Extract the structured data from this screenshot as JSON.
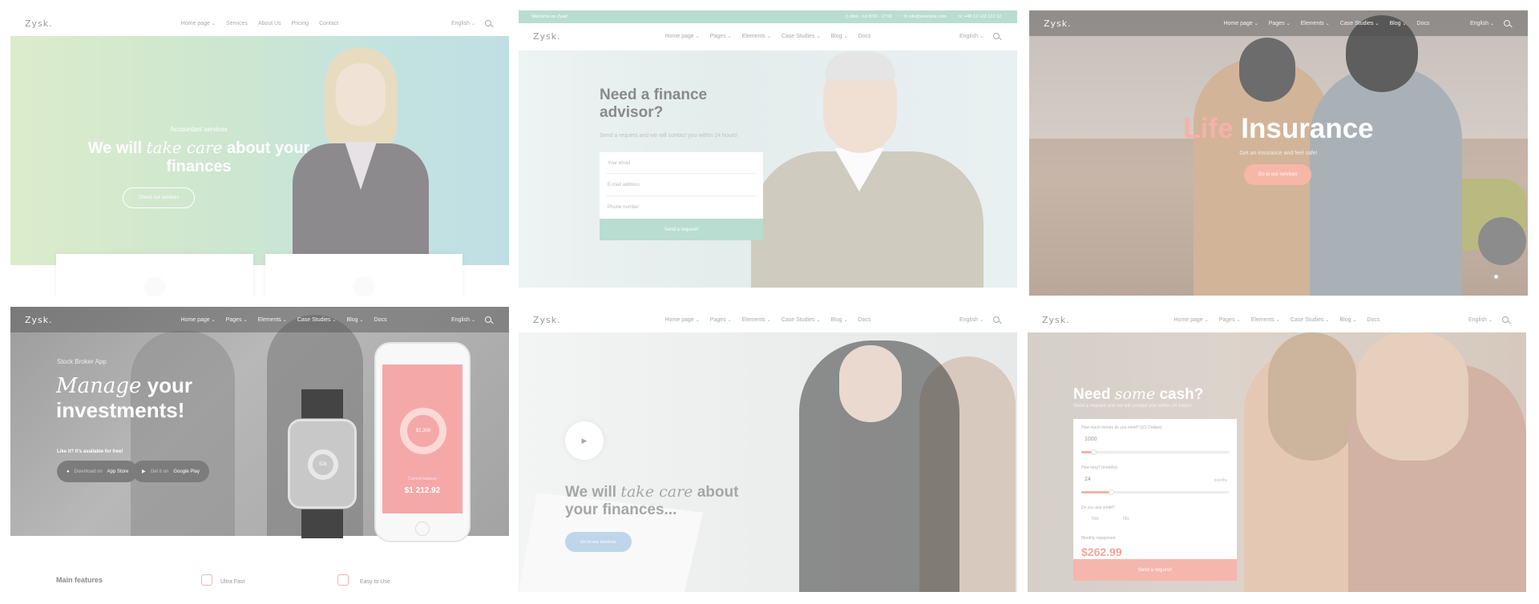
{
  "nav": {
    "logo": "Zysk.",
    "language": "English",
    "short_links": [
      "Home page",
      "Services",
      "About Us",
      "Pricing",
      "Contact"
    ],
    "links": [
      "Home page",
      "Pages",
      "Elements",
      "Case Studies",
      "Blog",
      "Docs"
    ]
  },
  "demo1": {
    "kicker": "Accountant services",
    "headline_pre": "We will",
    "headline_em": "take care",
    "headline_post": "about your finances",
    "button": "Check our services"
  },
  "demo2": {
    "welcome": "Welcome on Zysk!",
    "hours": "Mon - Fri 8:00 - 17:00",
    "email": "info@example.com",
    "phone": "+48 12 122 122 12",
    "headline": "Need a finance advisor?",
    "subtitle": "Send a request and we will contact you within 24 hours!",
    "field_email": "Your email",
    "field_address": "E-mail address",
    "field_phone": "Phone number",
    "submit": "Send a request!"
  },
  "demo3": {
    "title_accent": "Life",
    "title_main": "Insurance",
    "subtitle": "Get an insurance and feel safe!",
    "button": "Go to our services"
  },
  "demo4": {
    "kicker": "Stock Broker App",
    "headline_em": "Manage",
    "headline_rest": "your investments!",
    "available": "Like it? It's available for free!",
    "appstore_small": "Download on",
    "appstore": "App Store",
    "play_small": "Get it on",
    "play": "Google Play",
    "watch_value": "52k",
    "donut_value": "$2,300",
    "phone_label": "Current balance",
    "phone_amount": "$1 212.92",
    "features_title": "Main features",
    "feature1": "Ultra Fast",
    "feature2": "Easy to Use"
  },
  "demo5": {
    "play_glyph": "▶",
    "headline_pre": "We will",
    "headline_em": "take care",
    "headline_post": "about your finances...",
    "button": "Go to our services"
  },
  "demo6": {
    "headline_pre": "Need",
    "headline_em": "some",
    "headline_post": "cash?",
    "subtitle": "Send a request and we will contact you within 24 hours!",
    "amount_label": "How much money do you need? (US Dollars)",
    "amount_value": "1000",
    "amount_fill": 0.08,
    "term_label": "How long? (months)",
    "term_value": "24",
    "term_unit": "months",
    "term_fill": 0.2,
    "credit_label": "Do you any credit?",
    "opt_yes": "Yes",
    "opt_no": "No",
    "monthly_label": "Monthly repayment",
    "monthly_value": "$262.99",
    "submit": "Send a request!"
  }
}
